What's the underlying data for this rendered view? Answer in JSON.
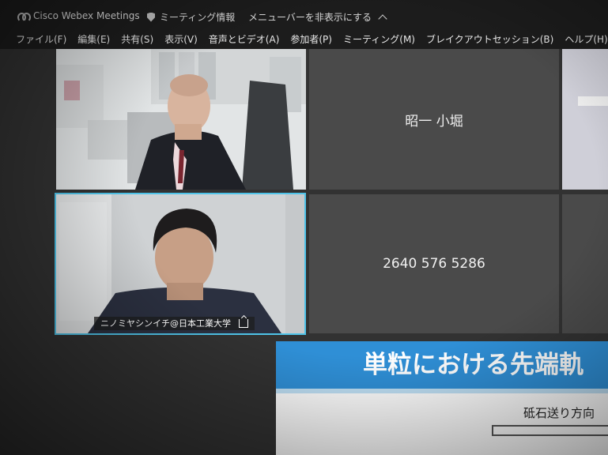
{
  "titlebar": {
    "app_name": "Cisco Webex Meetings",
    "meeting_info": "ミーティング情報",
    "hide_menubar": "メニューバーを非表示にする"
  },
  "menu": [
    "ファイル(F)",
    "編集(E)",
    "共有(S)",
    "表示(V)",
    "音声とビデオ(A)",
    "参加者(P)",
    "ミーティング(M)",
    "ブレイクアウトセッション(B)",
    "ヘルプ(H)"
  ],
  "participants": {
    "tile_name": "昭一 小堀",
    "tile_number": "2640 576 5286",
    "active_speaker": "ニノミヤシンイチ@日本工業大学"
  },
  "slide": {
    "title": "単粒における先端軌",
    "label": "砥石送り方向"
  },
  "colors": {
    "active_border": "#4fc3e8",
    "slide_header": "#2f8fd6"
  }
}
